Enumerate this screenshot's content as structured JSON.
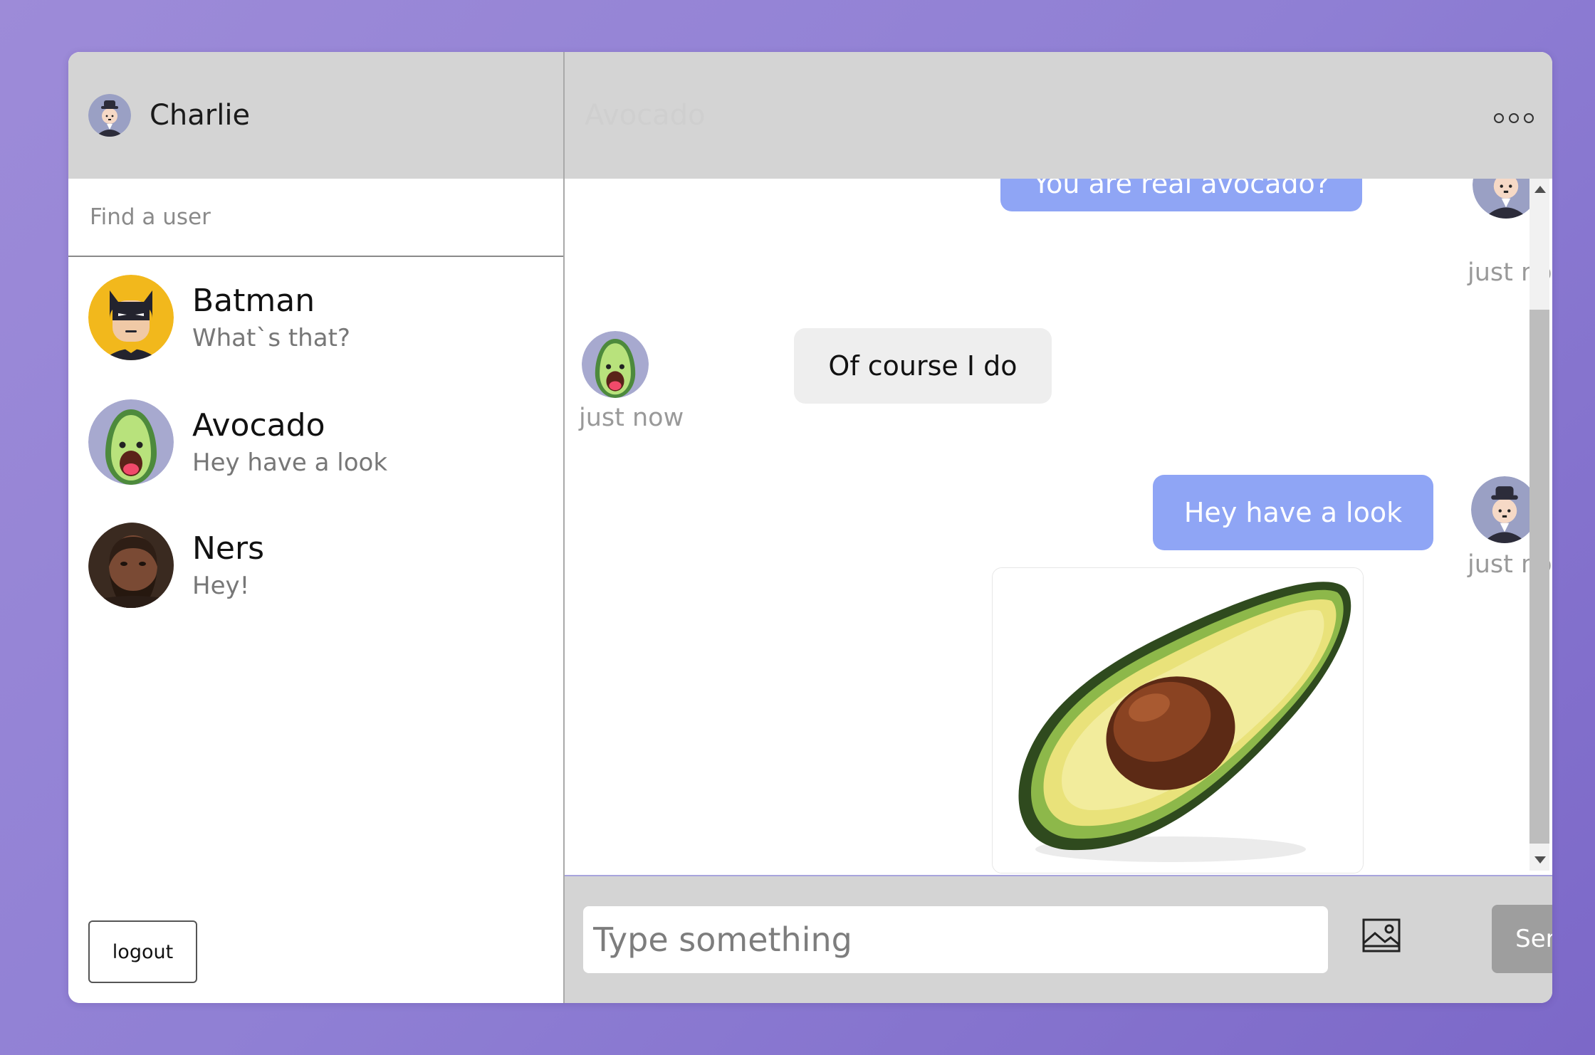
{
  "current_user": {
    "name": "Charlie"
  },
  "search": {
    "placeholder": "Find a user"
  },
  "contacts": [
    {
      "name": "Batman",
      "preview": "What`s that?"
    },
    {
      "name": "Avocado",
      "preview": "Hey have a look"
    },
    {
      "name": "Ners",
      "preview": "Hey!"
    }
  ],
  "logout_label": "logout",
  "chat": {
    "title": "Avocado",
    "messages": [
      {
        "sender": "me",
        "text": "You are real avocado?",
        "time": "just now"
      },
      {
        "sender": "them",
        "text": "Of course I do",
        "time": "just now"
      },
      {
        "sender": "me",
        "text": "Hey have a look",
        "time": "just now"
      }
    ]
  },
  "composer": {
    "placeholder": "Type something",
    "send_label": "Send"
  },
  "colors": {
    "accent": "#8fa5f5",
    "header_bg": "#d4d4d4",
    "background": "#8f7fd4"
  },
  "icons": {
    "menu": "more-dots-icon",
    "attach": "image-icon"
  }
}
